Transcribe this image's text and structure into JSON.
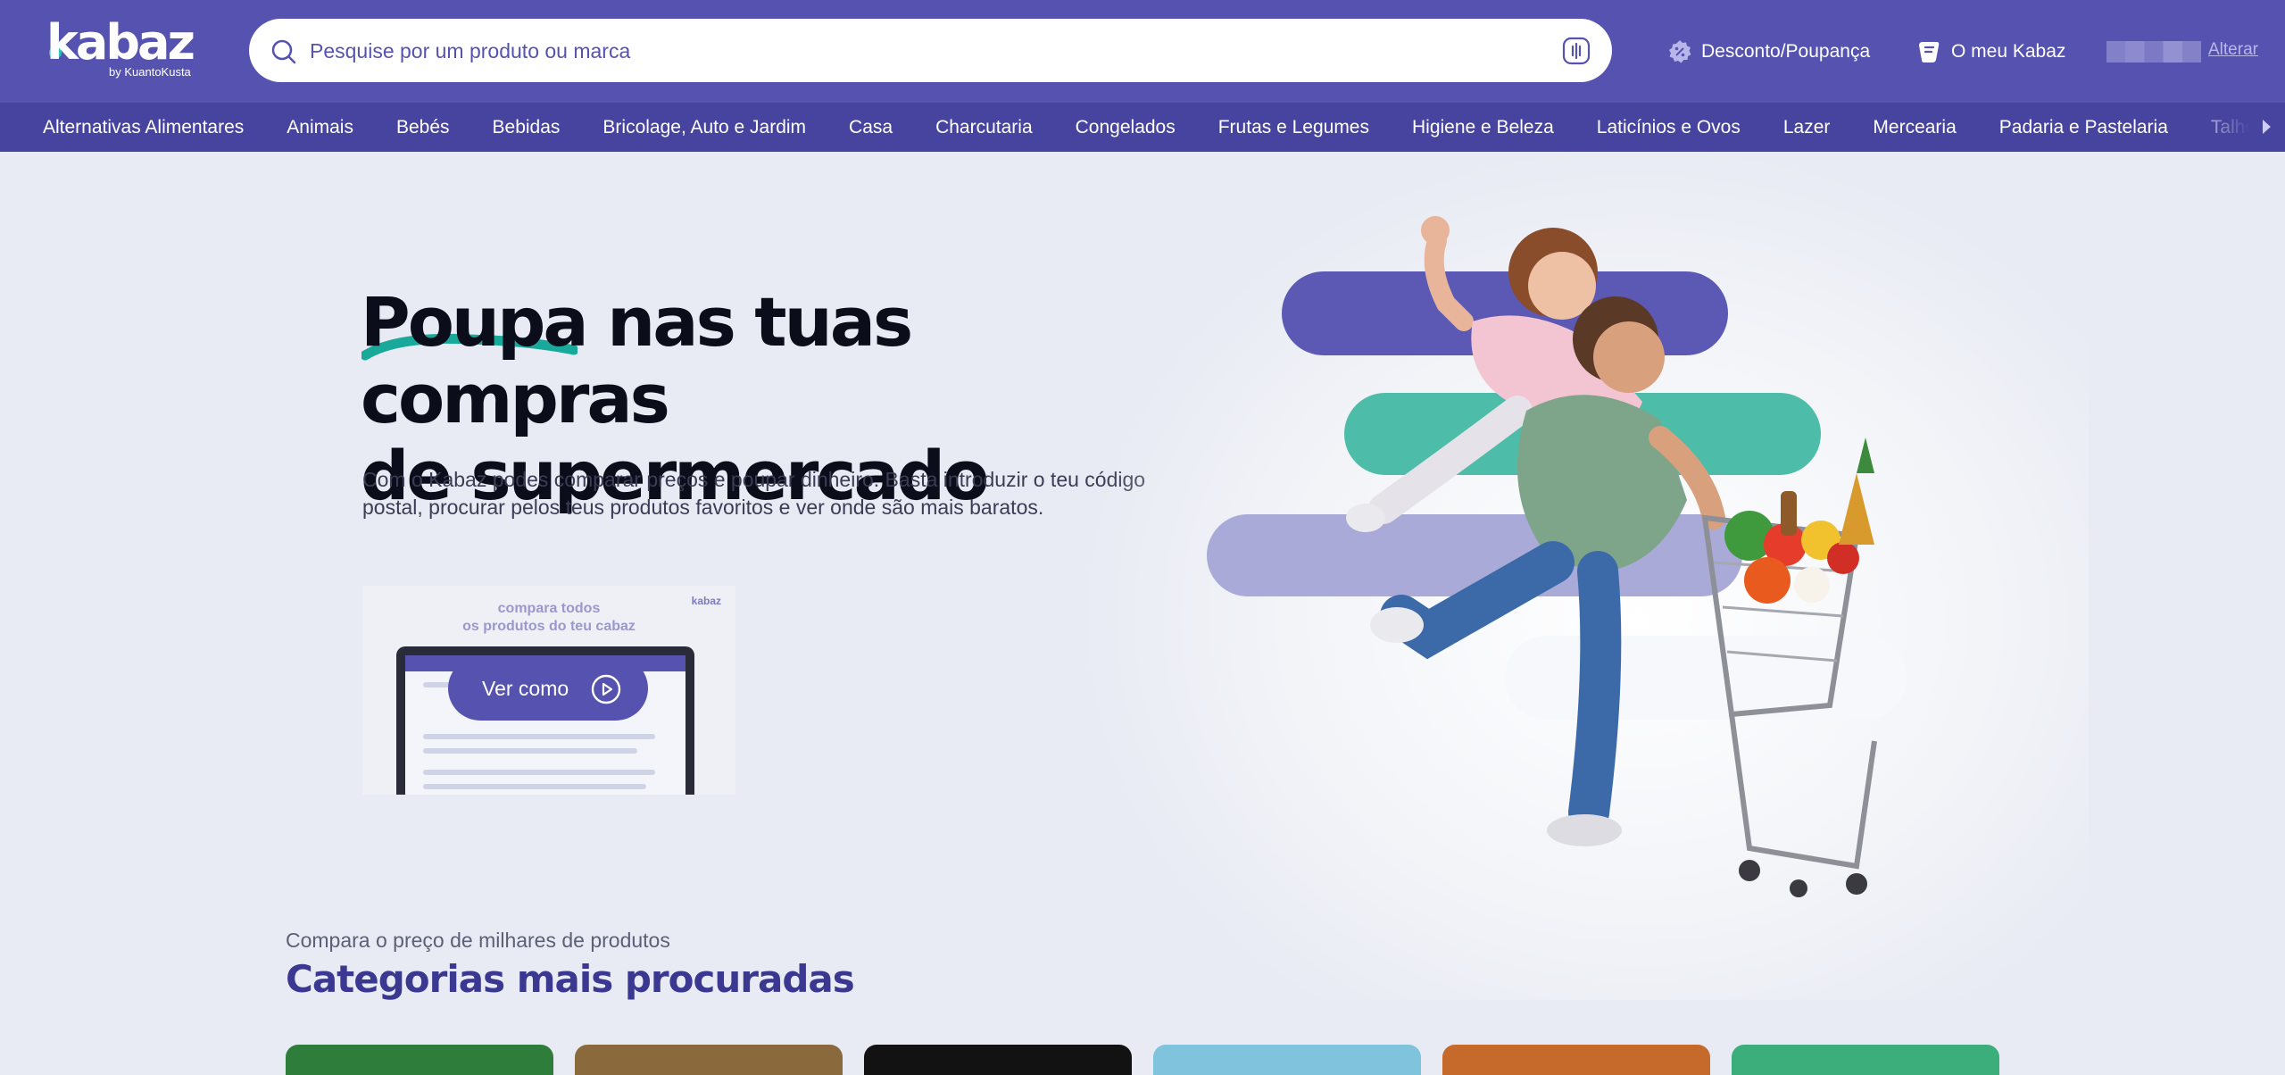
{
  "brand": {
    "name": "kabaz",
    "sub": "by KuantoKusta",
    "accent": "#5653b0",
    "teal": "#2ec4b6"
  },
  "search": {
    "placeholder": "Pesquise por um produto ou marca",
    "icon": "search-icon",
    "voice_icon": "microphone-icon"
  },
  "header_links": {
    "discount": "Desconto/Poupança",
    "my_kabaz": "O meu Kabaz",
    "change": "Alterar"
  },
  "categories_nav": [
    "Alternativas Alimentares",
    "Animais",
    "Bebés",
    "Bebidas",
    "Bricolage, Auto e Jardim",
    "Casa",
    "Charcutaria",
    "Congelados",
    "Frutas e Legumes",
    "Higiene e Beleza",
    "Laticínios e Ovos",
    "Lazer",
    "Mercearia",
    "Padaria e Pastelaria",
    "Talho"
  ],
  "hero": {
    "title_word": "Poupa",
    "title_rest_1": " nas tuas compras",
    "title_line_2": "de supermercado",
    "text": "Com o Kabaz podes comparar preços e poupar dinheiro. Basta introduzir o teu código postal, procurar pelos teus produtos favoritos e ver onde são mais baratos.",
    "video_heading_1": "compara todos",
    "video_heading_2": "os produtos do teu cabaz",
    "video_logo": "kabaz",
    "play_label": "Ver como"
  },
  "section": {
    "subtitle": "Compara o preço de milhares de produtos",
    "title": "Categorias mais procuradas"
  },
  "category_cards": [
    {
      "color": "#2f7d3a"
    },
    {
      "color": "#8a6a3c"
    },
    {
      "color": "#121212"
    },
    {
      "color": "#7fc3dd"
    },
    {
      "color": "#c66a2c"
    },
    {
      "color": "#3cae7c"
    }
  ]
}
